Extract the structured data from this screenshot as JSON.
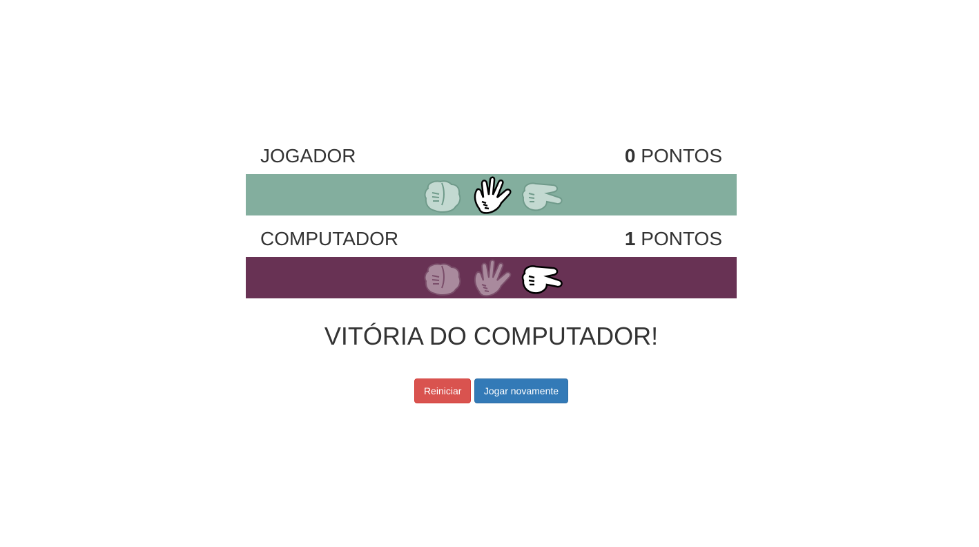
{
  "player": {
    "name": "JOGADOR",
    "score": "0",
    "score_suffix": "PONTOS",
    "bar_color": "#83ae9e",
    "selected": "paper",
    "hands": [
      "rock-icon",
      "paper-icon",
      "scissors-icon"
    ]
  },
  "computer": {
    "name": "COMPUTADOR",
    "score": "1",
    "score_suffix": "PONTOS",
    "bar_color": "#683254",
    "selected": "scissors",
    "hands": [
      "rock-icon",
      "paper-icon",
      "scissors-icon"
    ]
  },
  "result": {
    "text": "VITÓRIA DO COMPUTADOR!"
  },
  "buttons": {
    "restart_label": "Reiniciar",
    "play_again_label": "Jogar novamente"
  }
}
